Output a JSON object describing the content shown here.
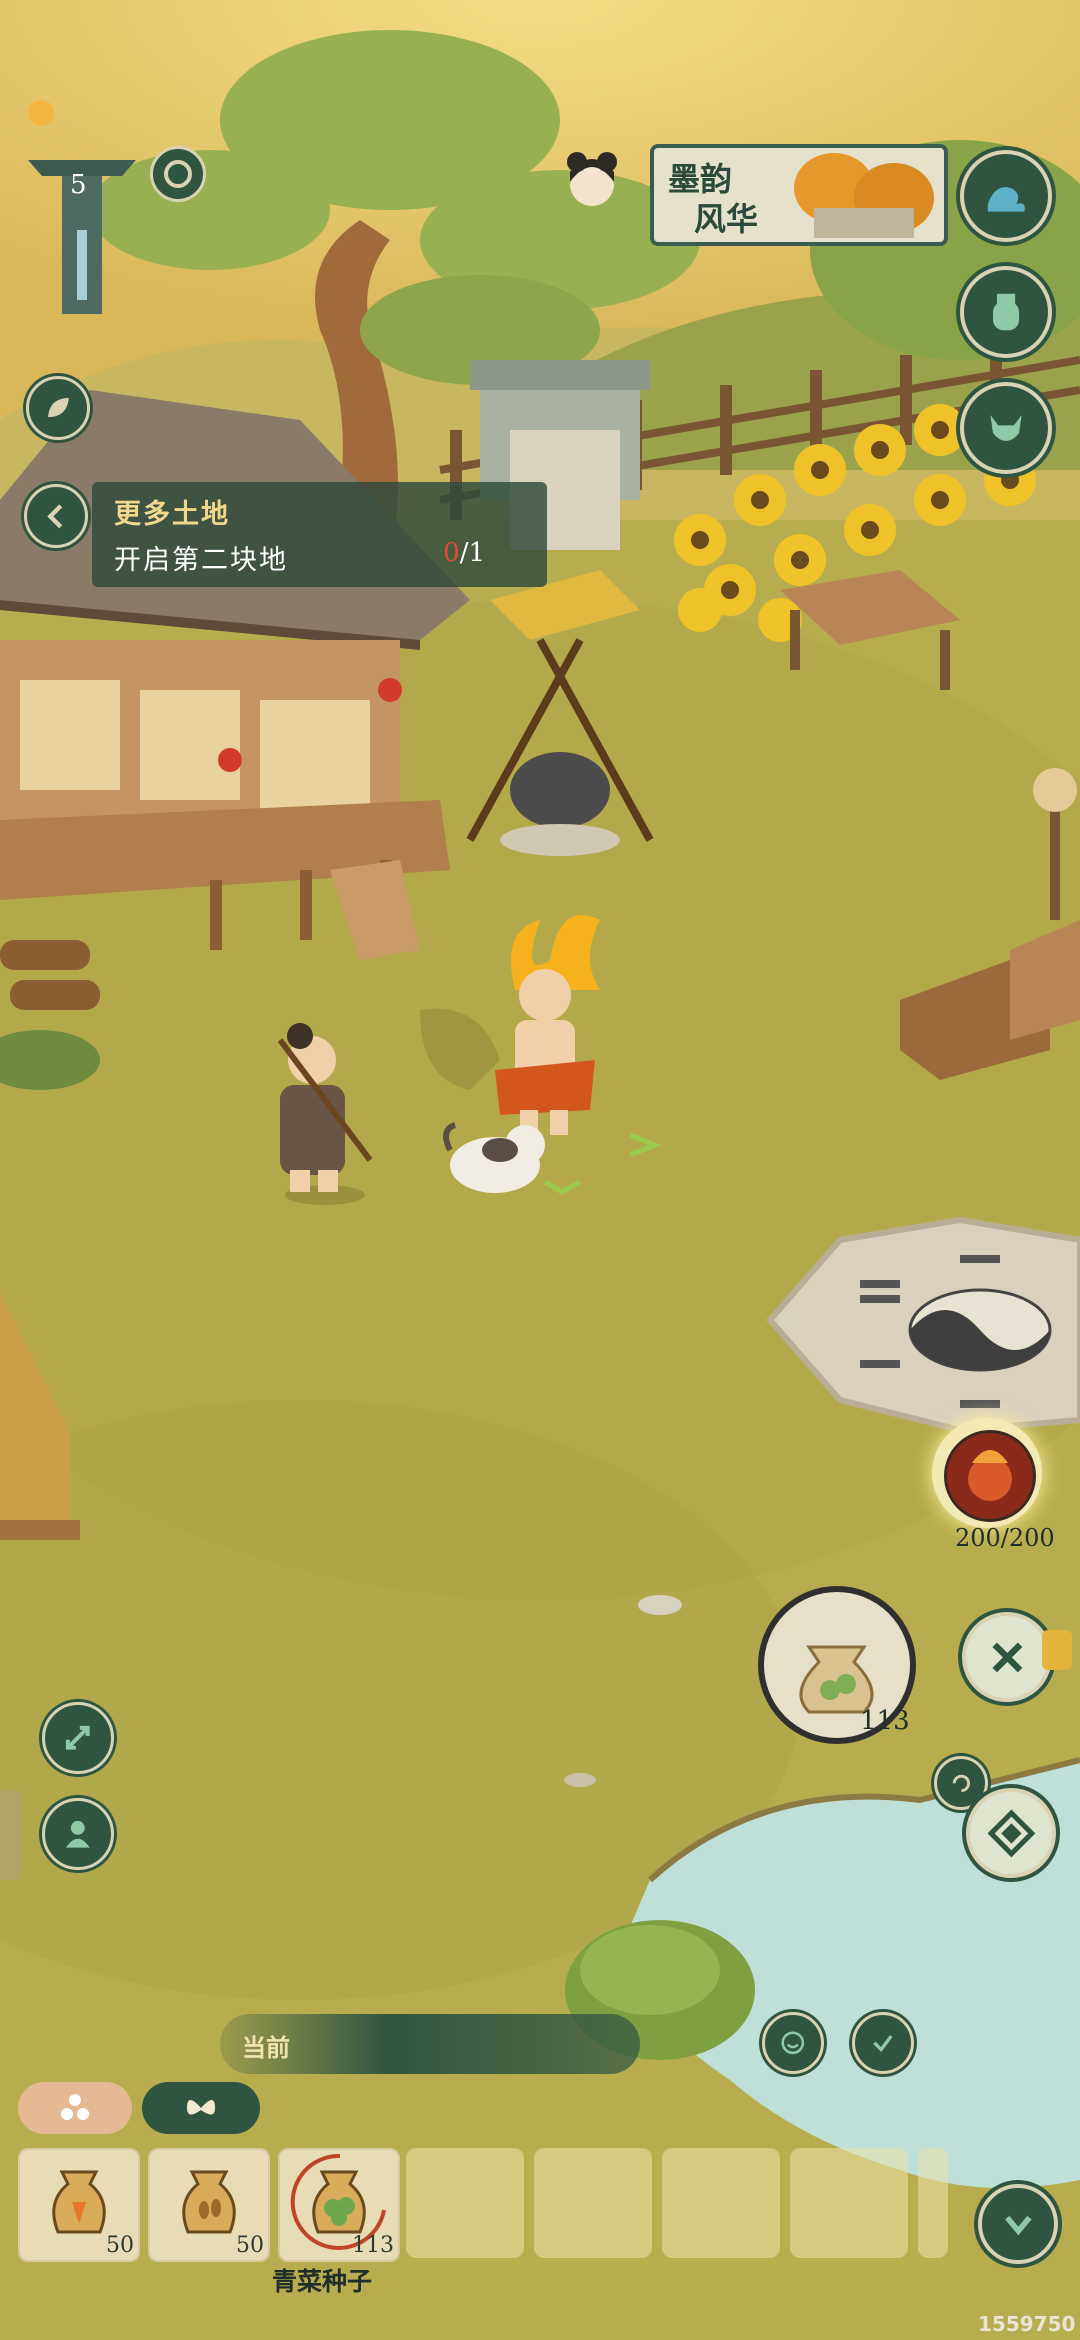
{
  "hud": {
    "level": "5",
    "banner_text_line1": "墨韵",
    "banner_text_line2": "风华",
    "stamina": "200/200",
    "seed_bag_count": "113",
    "watermark": "1559750"
  },
  "quest": {
    "title": "更多土地",
    "description": "开启第二块地",
    "progress_current": "0",
    "progress_total": "/1"
  },
  "bottom_bar": {
    "current_label": "当前",
    "selected_item_name": "青菜种子",
    "slots": [
      {
        "icon": "carrot-seed-bag-icon",
        "count": "50"
      },
      {
        "icon": "grain-seed-bag-icon",
        "count": "50"
      },
      {
        "icon": "green-vegetable-seed-bag-icon",
        "count": "113"
      },
      {
        "icon": "",
        "count": ""
      },
      {
        "icon": "",
        "count": ""
      },
      {
        "icon": "",
        "count": ""
      },
      {
        "icon": "",
        "count": ""
      }
    ]
  },
  "colors": {
    "ground": "#b7ab4a",
    "ui_dark_green": "#2f5540",
    "ui_cream": "#d9d3b4",
    "quest_progress_red": "#e24a3a",
    "quest_title_gold": "#f1d88c"
  }
}
